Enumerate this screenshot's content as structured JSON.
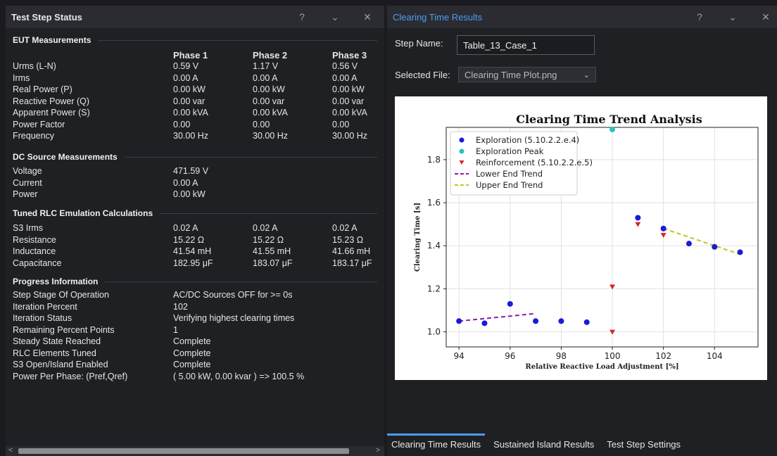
{
  "left_panel": {
    "title": "Test Step Status",
    "help_glyph": "?",
    "collapse_glyph": "⌄",
    "close_glyph": "✕",
    "eut": {
      "header": "EUT Measurements",
      "phases": [
        "Phase 1",
        "Phase 2",
        "Phase 3"
      ],
      "rows": [
        {
          "label": "Urms (L-N)",
          "values": [
            "0.59 V",
            "1.17 V",
            "0.56 V"
          ]
        },
        {
          "label": "Irms",
          "values": [
            "0.00 A",
            "0.00 A",
            "0.00 A"
          ]
        },
        {
          "label": "Real Power (P)",
          "values": [
            "0.00 kW",
            "0.00 kW",
            "0.00 kW"
          ]
        },
        {
          "label": "Reactive Power (Q)",
          "values": [
            "0.00 var",
            "0.00 var",
            "0.00 var"
          ]
        },
        {
          "label": "Apparent Power (S)",
          "values": [
            "0.00 kVA",
            "0.00 kVA",
            "0.00 kVA"
          ]
        },
        {
          "label": "Power Factor",
          "values": [
            "0.00",
            "0.00",
            "0.00"
          ]
        },
        {
          "label": "Frequency",
          "values": [
            "30.00 Hz",
            "30.00 Hz",
            "30.00 Hz"
          ]
        }
      ]
    },
    "dc": {
      "header": "DC Source Measurements",
      "rows": [
        {
          "label": "Voltage",
          "value": "471.59 V"
        },
        {
          "label": "Current",
          "value": "0.00 A"
        },
        {
          "label": "Power",
          "value": "0.00 kW"
        }
      ]
    },
    "rlc": {
      "header": "Tuned RLC Emulation Calculations",
      "rows": [
        {
          "label": "S3 Irms",
          "values": [
            "0.02 A",
            "0.02 A",
            "0.02 A"
          ]
        },
        {
          "label": "Resistance",
          "values": [
            "15.22 Ω",
            "15.22 Ω",
            "15.23 Ω"
          ]
        },
        {
          "label": "Inductance",
          "values": [
            "41.54 mH",
            "41.55 mH",
            "41.66 mH"
          ]
        },
        {
          "label": "Capacitance",
          "values": [
            "182.95 μF",
            "183.07 μF",
            "183.17 μF"
          ]
        }
      ]
    },
    "progress": {
      "header": "Progress Information",
      "rows": [
        {
          "label": "Step Stage Of Operation",
          "value": "AC/DC Sources OFF for >= 0s"
        },
        {
          "label": "Iteration Percent",
          "value": "102"
        },
        {
          "label": "Iteration Status",
          "value": "Verifying highest clearing times"
        },
        {
          "label": "Remaining Percent Points",
          "value": "1"
        },
        {
          "label": "Steady State Reached",
          "value": "Complete"
        },
        {
          "label": "RLC Elements Tuned",
          "value": "Complete"
        },
        {
          "label": "S3 Open/Island Enabled",
          "value": "Complete"
        },
        {
          "label": "Power Per Phase: (Pref,Qref)",
          "value": "( 5.00 kW, 0.00 kvar ) => 100.5 %"
        }
      ]
    },
    "scroll_left_glyph": "<",
    "scroll_right_glyph": ">"
  },
  "right_panel": {
    "title": "Clearing Time Results",
    "help_glyph": "?",
    "collapse_glyph": "⌄",
    "close_glyph": "✕",
    "step_name_label": "Step Name:",
    "step_name_value": "Table_13_Case_1",
    "selected_file_label": "Selected File:",
    "selected_file_value": "Clearing Time Plot.png",
    "tabs": [
      "Clearing Time Results",
      "Sustained Island Results",
      "Test Step Settings"
    ],
    "active_tab": "Clearing Time Results"
  },
  "chart_data": {
    "type": "scatter",
    "title": "Clearing Time Trend Analysis",
    "xlabel": "Relative Reactive Load Adjustment [%]",
    "ylabel": "Clearing Time [s]",
    "xlim": [
      93.5,
      105.7
    ],
    "ylim": [
      0.93,
      1.95
    ],
    "xticks": [
      94,
      96,
      98,
      100,
      102,
      104
    ],
    "yticks": [
      1.0,
      1.2,
      1.4,
      1.6,
      1.8
    ],
    "grid": true,
    "legend_position": "upper-left",
    "series": [
      {
        "name": "Exploration (5.10.2.2.e.4)",
        "marker": "circle",
        "color": "#1a1adb",
        "x": [
          94,
          95,
          96,
          97,
          98,
          99,
          101,
          102,
          103,
          104,
          105
        ],
        "y": [
          1.05,
          1.04,
          1.13,
          1.05,
          1.05,
          1.045,
          1.53,
          1.48,
          1.41,
          1.395,
          1.37
        ]
      },
      {
        "name": "Exploration Peak",
        "marker": "circle",
        "color": "#2bc2c2",
        "x": [
          100
        ],
        "y": [
          1.94
        ]
      },
      {
        "name": "Reinforcement (5.10.2.2.e.5)",
        "marker": "triangle-down",
        "color": "#d62728",
        "x": [
          100,
          100,
          101,
          102
        ],
        "y": [
          1.21,
          1.0,
          1.5,
          1.45
        ]
      },
      {
        "name": "Lower End Trend",
        "marker": "dashed-line",
        "color": "#8b1fa5",
        "x": [
          94,
          97
        ],
        "y": [
          1.05,
          1.085
        ]
      },
      {
        "name": "Upper End Trend",
        "marker": "dashed-line",
        "color": "#c9c21e",
        "x": [
          102,
          105
        ],
        "y": [
          1.48,
          1.36
        ]
      }
    ]
  }
}
